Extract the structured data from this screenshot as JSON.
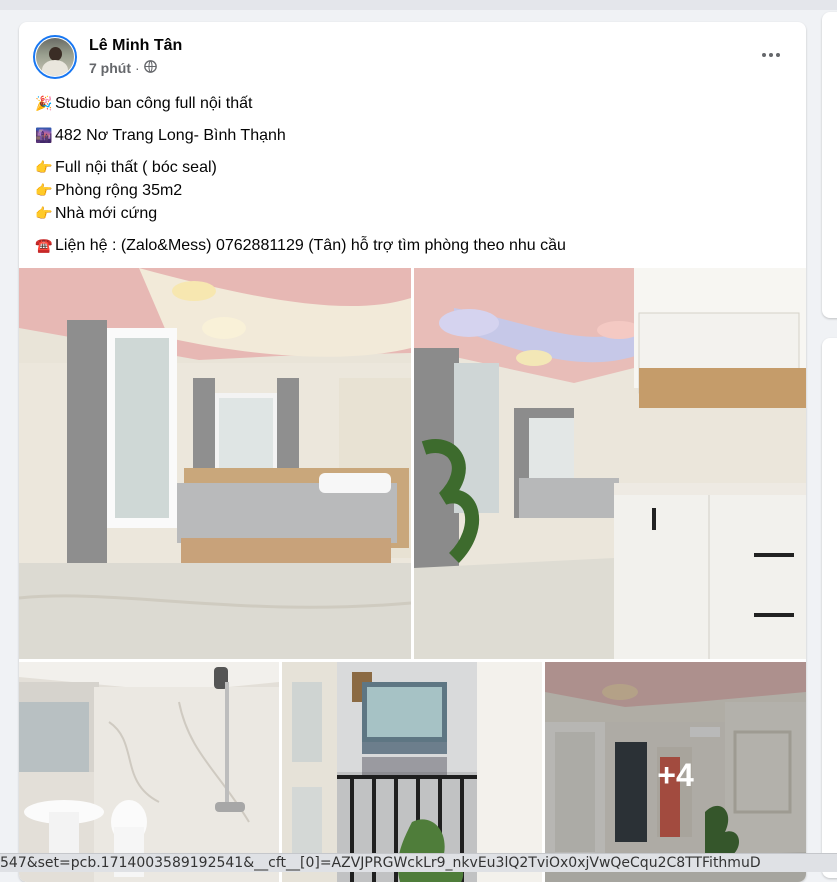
{
  "post": {
    "author": "Lê Minh Tân",
    "time": "7 phút",
    "separator": "·",
    "privacy_icon": "globe-icon",
    "lines": [
      {
        "emoji": "🎉",
        "text": "Studio ban công full nội thất"
      },
      {
        "emoji": "🌆",
        "text": "482 Nơ Trang Long- Bình Thạnh"
      },
      {
        "emoji": "👉",
        "text": "Full nội thất ( bóc seal)"
      },
      {
        "emoji": "👉",
        "text": "Phòng rộng 35m2"
      },
      {
        "emoji": "👉",
        "text": "Nhà mới cứng"
      },
      {
        "emoji": "☎️",
        "text": "Liện hệ : (Zalo&Mess) 0762881129 (Tân) hỗ trợ tìm phòng theo nhu cầu"
      }
    ],
    "photos": {
      "count": 5,
      "more_label": "+4"
    }
  },
  "status_bar": {
    "url": "547&set=pcb.1714003589192541&__cft__[0]=AZVJPRGWckLr9_nkvEu3lQ2TviOx0xjVwQeCqu2C8TTFithmuD"
  },
  "colors": {
    "accent": "#1877f2",
    "background": "#f0f2f5",
    "secondary_text": "#65676b"
  }
}
